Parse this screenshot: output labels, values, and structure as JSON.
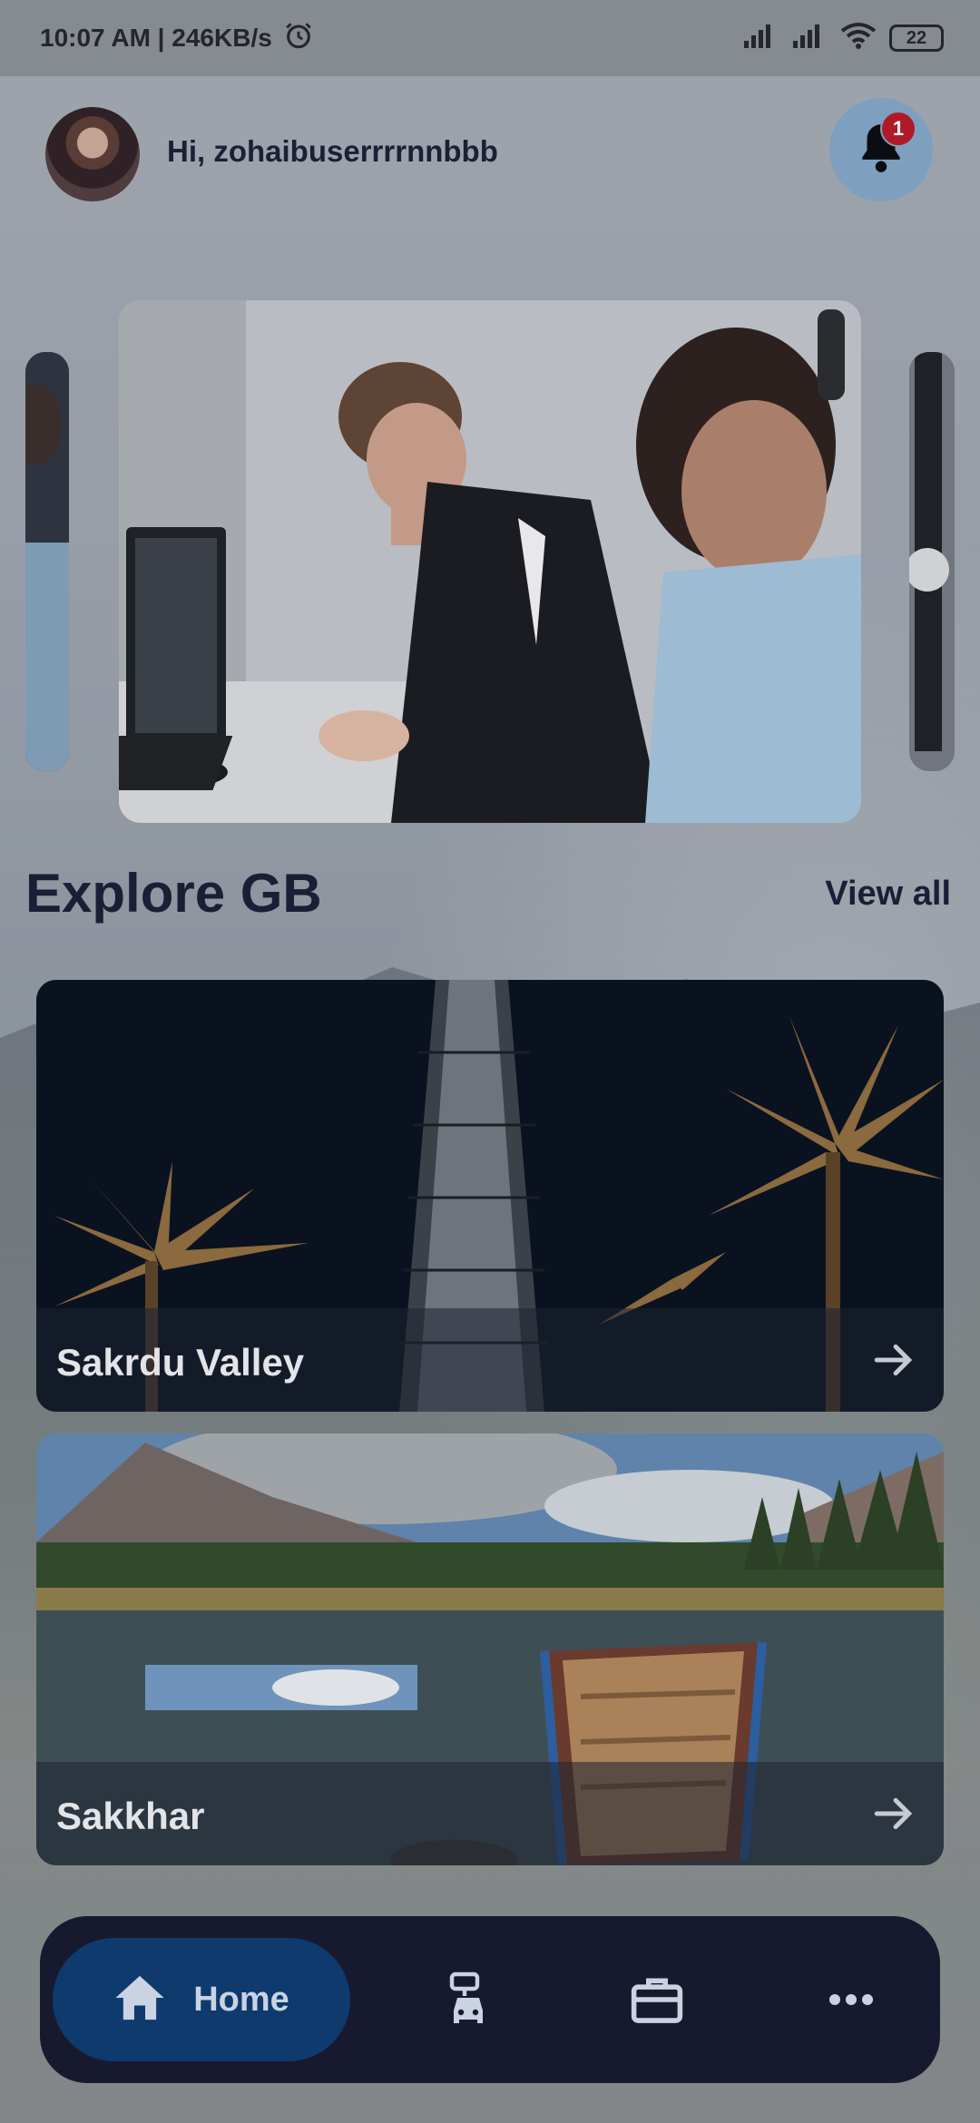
{
  "status_bar": {
    "time_speed": "10:07 AM | 246KB/s",
    "battery": "22"
  },
  "header": {
    "greeting": "Hi, zohaibuserrrrnnbbb",
    "notification_count": "1"
  },
  "explore": {
    "title": "Explore GB",
    "view_all": "View all"
  },
  "destinations": [
    {
      "name": "Sakrdu Valley"
    },
    {
      "name": "Sakkhar"
    }
  ],
  "bottom_nav": {
    "home_label": "Home",
    "items": [
      "home-icon",
      "taxi-icon",
      "briefcase-icon",
      "more-icon"
    ]
  },
  "colors": {
    "nav_bg": "#171a2e",
    "nav_active": "#0e3a6e",
    "badge": "#b01a26",
    "title_text": "#1a1f36"
  }
}
